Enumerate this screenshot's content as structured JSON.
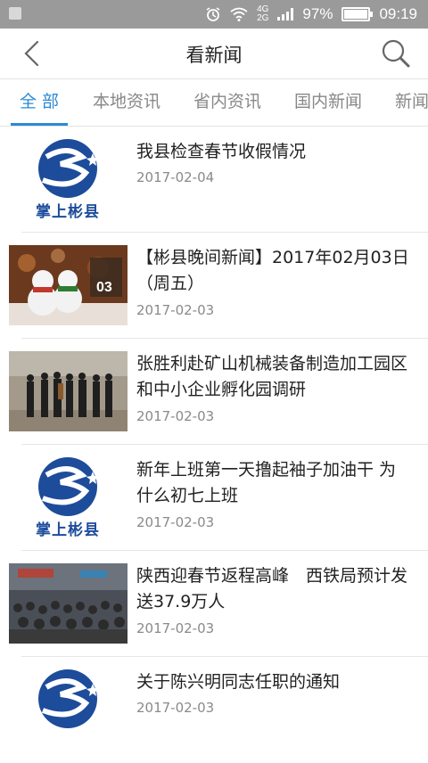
{
  "statusbar": {
    "network_top": "4G",
    "network_bottom": "2G",
    "battery": "97%",
    "time": "09:19"
  },
  "header": {
    "title": "看新闻"
  },
  "tabs": [
    {
      "label": "全 部",
      "active": true
    },
    {
      "label": "本地资讯",
      "active": false
    },
    {
      "label": "省内资讯",
      "active": false
    },
    {
      "label": "国内新闻",
      "active": false
    },
    {
      "label": "新闻",
      "active": false
    }
  ],
  "logo": {
    "caption": "掌上彬县",
    "brand_color": "#1d4c9b"
  },
  "news": [
    {
      "title": "我县检查春节收假情况",
      "date": "2017-02-04",
      "thumb": "logo"
    },
    {
      "title": "【彬县晚间新闻】2017年02月03日（周五）",
      "date": "2017-02-03",
      "thumb": "snowmen"
    },
    {
      "title": "张胜利赴矿山机械装备制造加工园区和中小企业孵化园调研",
      "date": "2017-02-03",
      "thumb": "group-photo"
    },
    {
      "title": "新年上班第一天撸起袖子加油干 为什么初七上班",
      "date": "2017-02-03",
      "thumb": "logo"
    },
    {
      "title": "陕西迎春节返程高峰　西铁局预计发送37.9万人",
      "date": "2017-02-03",
      "thumb": "crowd"
    },
    {
      "title": "关于陈兴明同志任职的通知",
      "date": "2017-02-03",
      "thumb": "logo"
    }
  ],
  "thumb_text": {
    "snowmen_badge": "03"
  },
  "colors": {
    "accent": "#2d8ad4",
    "statusbar": "#9a9a9a"
  }
}
